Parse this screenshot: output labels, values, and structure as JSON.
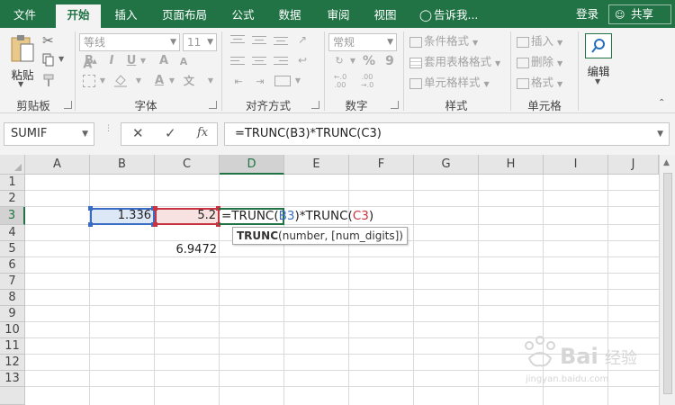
{
  "tabs": {
    "file": "文件",
    "home": "开始",
    "insert": "插入",
    "page_layout": "页面布局",
    "formulas": "公式",
    "data": "数据",
    "review": "审阅",
    "view": "视图",
    "tell_me": "告诉我..."
  },
  "header": {
    "login": "登录",
    "share": "共享"
  },
  "ribbon": {
    "clipboard": {
      "paste": "粘贴",
      "label": "剪贴板"
    },
    "font": {
      "name": "等线",
      "size": "11",
      "bold": "B",
      "italic": "I",
      "underline": "U",
      "label": "字体"
    },
    "alignment": {
      "label": "对齐方式"
    },
    "number": {
      "format": "常规",
      "percent": "%",
      "comma": "9",
      "label": "数字"
    },
    "styles": {
      "conditional": "条件格式",
      "table": "套用表格格式",
      "cell": "单元格样式",
      "label": "样式"
    },
    "cells": {
      "insert": "插入",
      "delete": "删除",
      "format": "格式",
      "label": "单元格"
    },
    "editing": {
      "label": "编辑"
    }
  },
  "formula_bar": {
    "name_box": "SUMIF",
    "fx": "fx",
    "formula": "=TRUNC(B3)*TRUNC(C3)"
  },
  "grid": {
    "columns": [
      "A",
      "B",
      "C",
      "D",
      "E",
      "F",
      "G",
      "H",
      "I",
      "J"
    ],
    "rows": [
      "1",
      "2",
      "3",
      "4",
      "5",
      "6",
      "7",
      "8",
      "9",
      "10",
      "11",
      "12",
      "13"
    ],
    "cells": {
      "b3": "1.336",
      "c3": "5.2",
      "c5": "6.9472"
    },
    "edit": {
      "prefix": "=TRUNC(",
      "ref1": "B3",
      "mid": ")*TRUNC(",
      "ref2": "C3",
      "suffix": ")"
    },
    "tooltip": {
      "func": "TRUNC",
      "args": "(number, [num_digits])"
    }
  },
  "colors": {
    "accent": "#217346",
    "ref1": "#3b6cc4",
    "ref2": "#c7333f"
  }
}
